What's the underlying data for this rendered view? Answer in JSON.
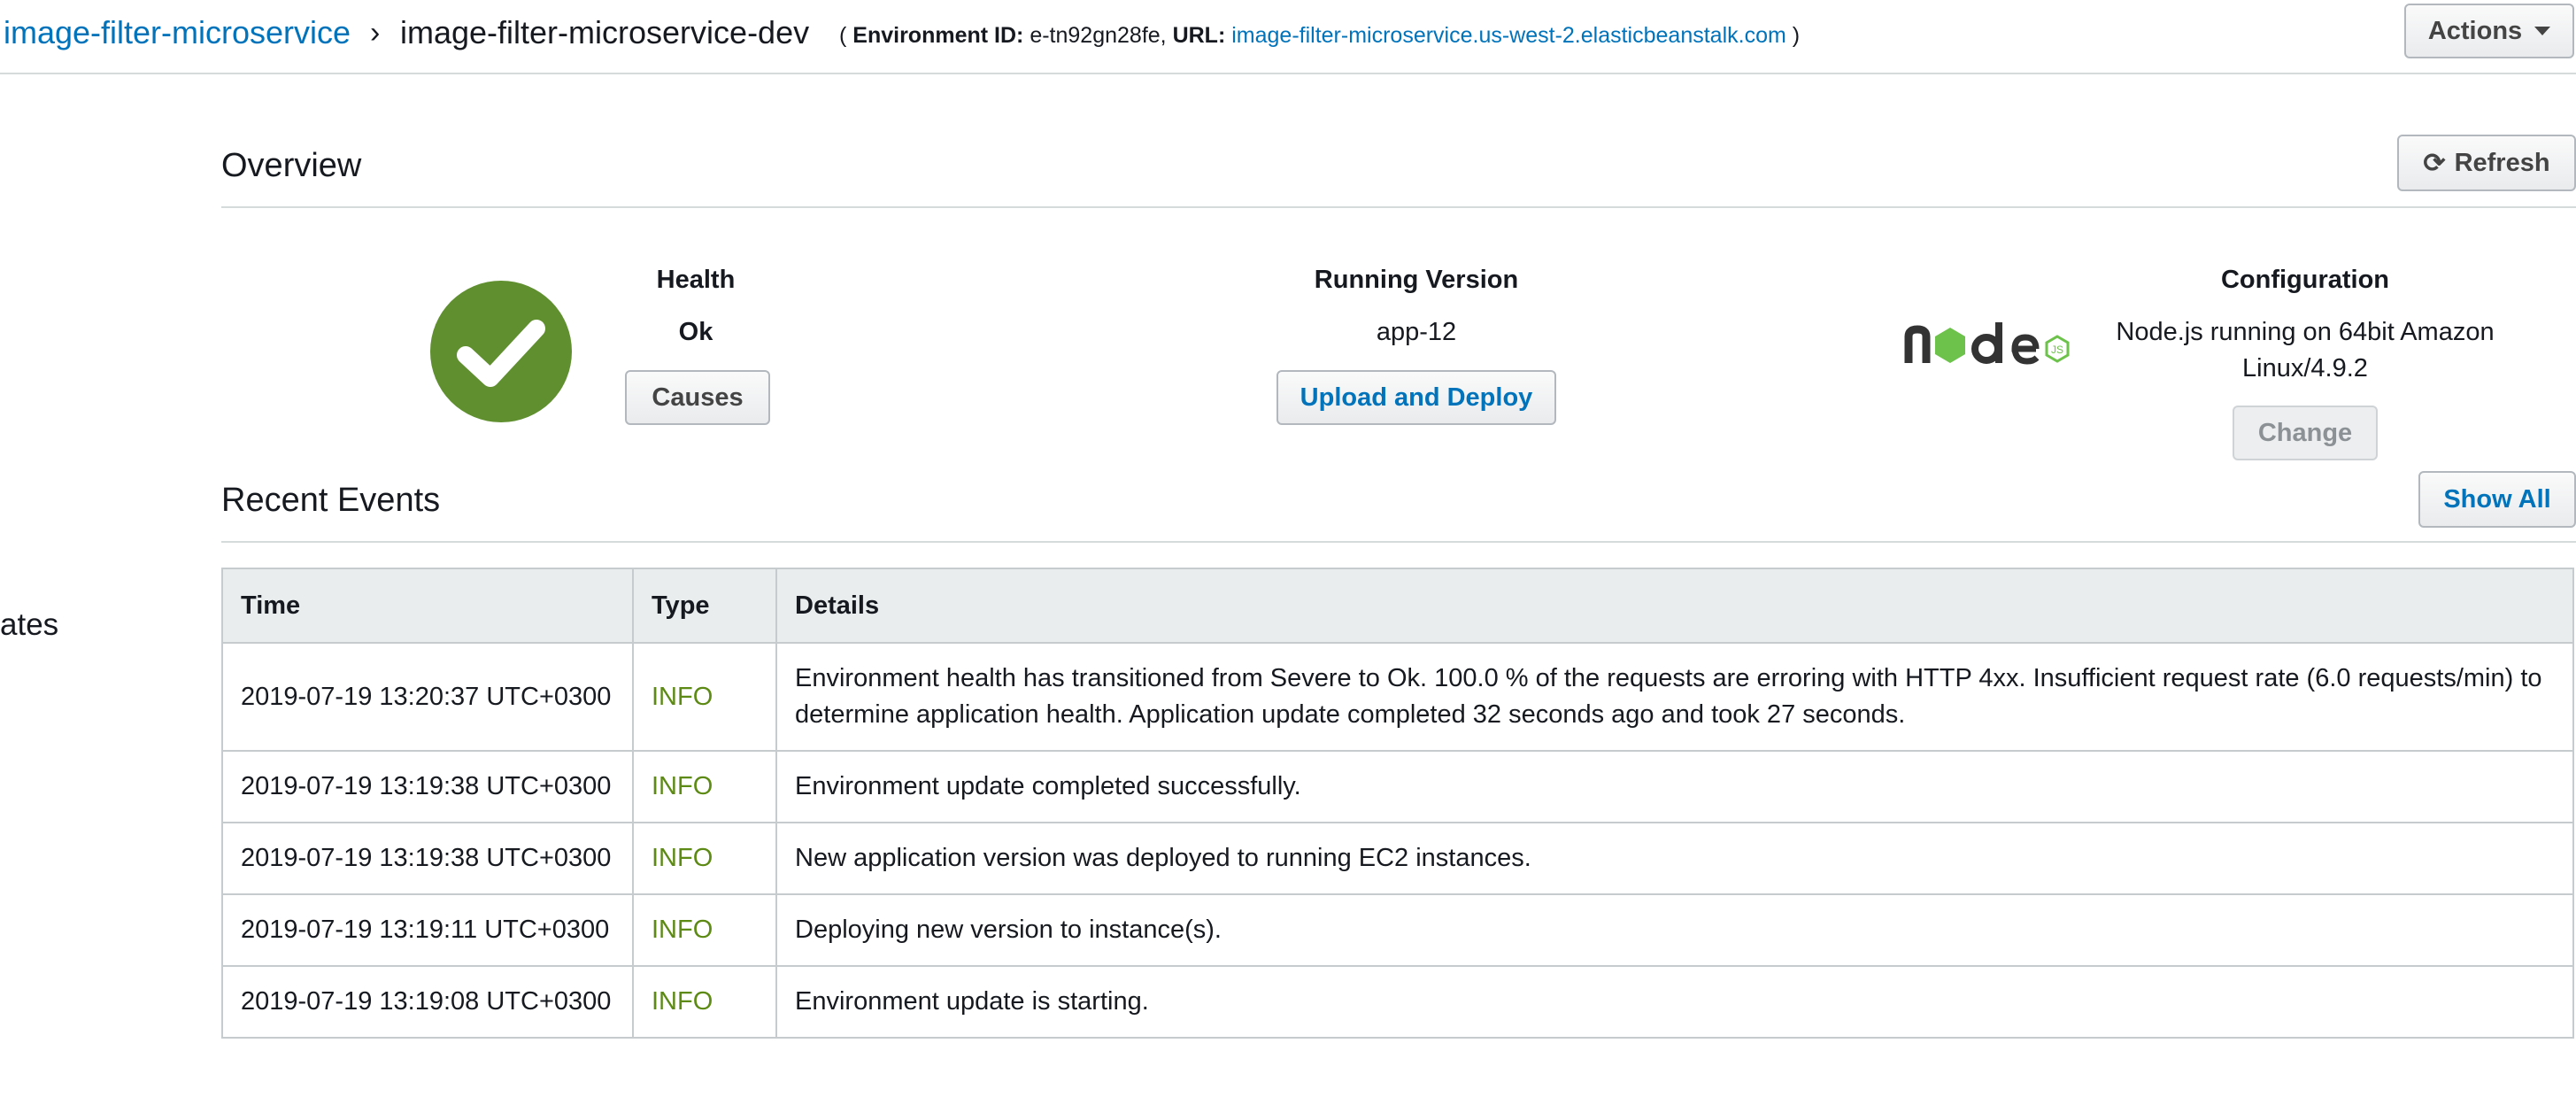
{
  "header": {
    "app_name": "image-filter-microservice",
    "separator": "›",
    "env_name": "image-filter-microservice-dev",
    "env_open": "( ",
    "env_id_label": "Environment ID:",
    "env_id": "e-tn92gn28fe,",
    "url_label": "URL:",
    "url": "image-filter-microservice.us-west-2.elasticbeanstalk.com",
    "env_close": " )",
    "actions_label": "Actions"
  },
  "side_nav": {
    "fragment": "ates"
  },
  "overview": {
    "title": "Overview",
    "refresh_label": "Refresh",
    "health": {
      "label": "Health",
      "value": "Ok",
      "button": "Causes",
      "status_color": "#5f8f2f"
    },
    "running_version": {
      "label": "Running Version",
      "value": "app-12",
      "button": "Upload and Deploy"
    },
    "configuration": {
      "label": "Configuration",
      "line1": "Node.js running on 64bit Amazon",
      "line2": "Linux/4.9.2",
      "button": "Change",
      "logo_icon": "nodejs-logo"
    }
  },
  "events": {
    "title": "Recent Events",
    "show_all_label": "Show All",
    "columns": [
      "Time",
      "Type",
      "Details"
    ],
    "rows": [
      {
        "time": "2019-07-19 13:20:37 UTC+0300",
        "type": "INFO",
        "details": "Environment health has transitioned from Severe to Ok. 100.0 % of the requests are erroring with HTTP 4xx. Insufficient request rate (6.0 requests/min) to determine application health. Application update completed 32 seconds ago and took 27 seconds."
      },
      {
        "time": "2019-07-19 13:19:38 UTC+0300",
        "type": "INFO",
        "details": "Environment update completed successfully."
      },
      {
        "time": "2019-07-19 13:19:38 UTC+0300",
        "type": "INFO",
        "details": "New application version was deployed to running EC2 instances."
      },
      {
        "time": "2019-07-19 13:19:11 UTC+0300",
        "type": "INFO",
        "details": "Deploying new version to instance(s)."
      },
      {
        "time": "2019-07-19 13:19:08 UTC+0300",
        "type": "INFO",
        "details": "Environment update is starting."
      }
    ]
  },
  "colors": {
    "link": "#0073bb",
    "info": "#5c8a14",
    "ok": "#5f8f2f"
  }
}
